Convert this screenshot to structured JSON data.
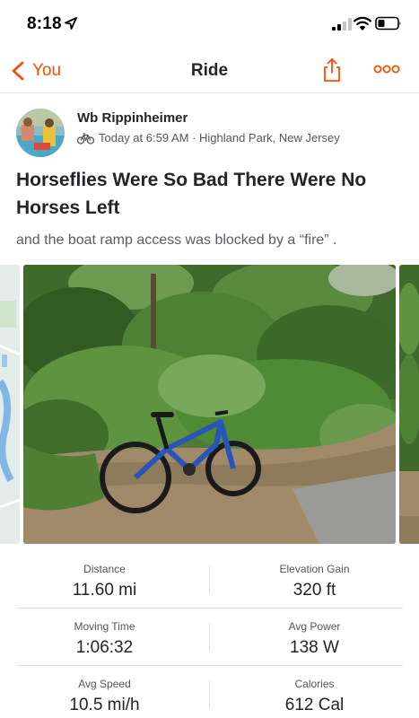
{
  "status_bar": {
    "time": "8:18"
  },
  "nav": {
    "back_label": "You",
    "title": "Ride"
  },
  "athlete": {
    "name": "Wb Rippinheimer"
  },
  "activity": {
    "meta": "Today at 6:59 AM · Highland Park, New Jersey",
    "title": "Horseflies Were So Bad There Were No Horses Left",
    "description": "and the boat ramp access was blocked by a “fire” ."
  },
  "stats": [
    [
      {
        "label": "Distance",
        "value": "11.60 mi"
      },
      {
        "label": "Elevation Gain",
        "value": "320 ft"
      }
    ],
    [
      {
        "label": "Moving Time",
        "value": "1:06:32"
      },
      {
        "label": "Avg Power",
        "value": "138 W"
      }
    ],
    [
      {
        "label": "Avg Speed",
        "value": "10.5 mi/h"
      },
      {
        "label": "Calories",
        "value": "612 Cal"
      }
    ]
  ],
  "icons": [
    "location-arrow-icon",
    "signal-icon",
    "wifi-icon",
    "battery-icon",
    "chevron-left-icon",
    "share-icon",
    "more-icon",
    "bike-icon"
  ],
  "colors": {
    "accent": "#fc4c02",
    "text": "#242428",
    "muted": "#5b5b63"
  }
}
